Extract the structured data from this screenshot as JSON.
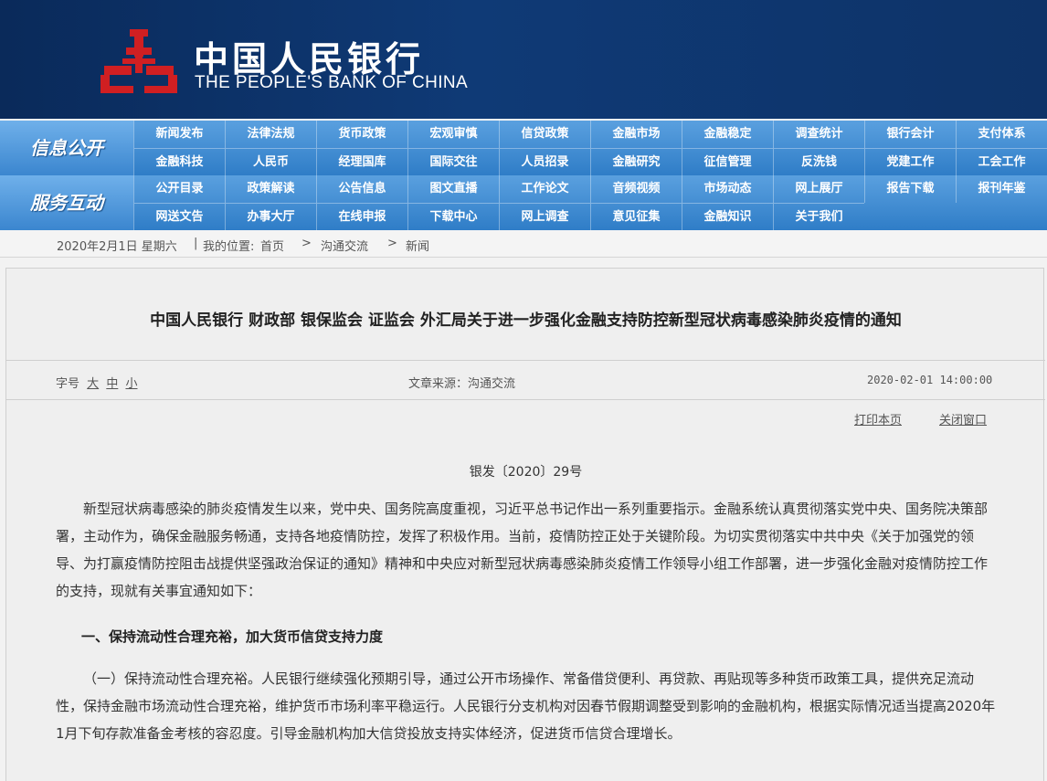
{
  "header": {
    "logo_cn": "中国人民银行",
    "logo_en": "THE PEOPLE'S BANK OF CHINA",
    "colors": {
      "bg": "#0f3a76",
      "emblem": "#d01f22"
    }
  },
  "nav": {
    "section1_label": "信息公开",
    "section1_items": [
      "新闻发布",
      "法律法规",
      "货币政策",
      "宏观审慎",
      "信贷政策",
      "金融市场",
      "金融稳定",
      "调查统计",
      "银行会计",
      "支付体系",
      "金融科技",
      "人民币",
      "经理国库",
      "国际交往",
      "人员招录",
      "金融研究",
      "征信管理",
      "反洗钱",
      "党建工作",
      "工会工作"
    ],
    "section2_label": "服务互动",
    "section2_items": [
      "公开目录",
      "政策解读",
      "公告信息",
      "图文直播",
      "工作论文",
      "音频视频",
      "市场动态",
      "网上展厅",
      "报告下载",
      "报刊年鉴",
      "网送文告",
      "办事大厅",
      "在线申报",
      "下载中心",
      "网上调查",
      "意见征集",
      "金融知识",
      "关于我们"
    ]
  },
  "breadcrumb": {
    "date": "2020年2月1日 星期六",
    "sep1": "|",
    "location_label": "我的位置:",
    "home": "首页",
    "arrow": ">",
    "level2": "沟通交流",
    "level3": "新闻"
  },
  "article": {
    "title": "中国人民银行 财政部 银保监会 证监会 外汇局关于进一步强化金融支持防控新型冠状病毒感染肺炎疫情的通知",
    "font_label": "字号",
    "font_sizes": [
      "大",
      "中",
      "小"
    ],
    "source": "文章来源：沟通交流",
    "datetime": "2020-02-01 14:00:00",
    "print_link": "打印本页",
    "close_link": "关闭窗口",
    "doc_number": "银发〔2020〕29号",
    "para1": "新型冠状病毒感染的肺炎疫情发生以来，党中央、国务院高度重视，习近平总书记作出一系列重要指示。金融系统认真贯彻落实党中央、国务院决策部署，主动作为，确保金融服务畅通，支持各地疫情防控，发挥了积极作用。当前，疫情防控正处于关键阶段。为切实贯彻落实中共中央《关于加强党的领导、为打赢疫情防控阻击战提供坚强政治保证的通知》精神和中央应对新型冠状病毒感染肺炎疫情工作领导小组工作部署，进一步强化金融对疫情防控工作的支持，现就有关事宜通知如下：",
    "section1_heading": "一、保持流动性合理充裕，加大货币信贷支持力度",
    "para2": "（一）保持流动性合理充裕。人民银行继续强化预期引导，通过公开市场操作、常备借贷便利、再贷款、再贴现等多种货币政策工具，提供充足流动性，保持金融市场流动性合理充裕，维护货币市场利率平稳运行。人民银行分支机构对因春节假期调整受到影响的金融机构，根据实际情况适当提高2020年1月下旬存款准备金考核的容忍度。引导金融机构加大信贷投放支持实体经济，促进货币信贷合理增长。"
  }
}
